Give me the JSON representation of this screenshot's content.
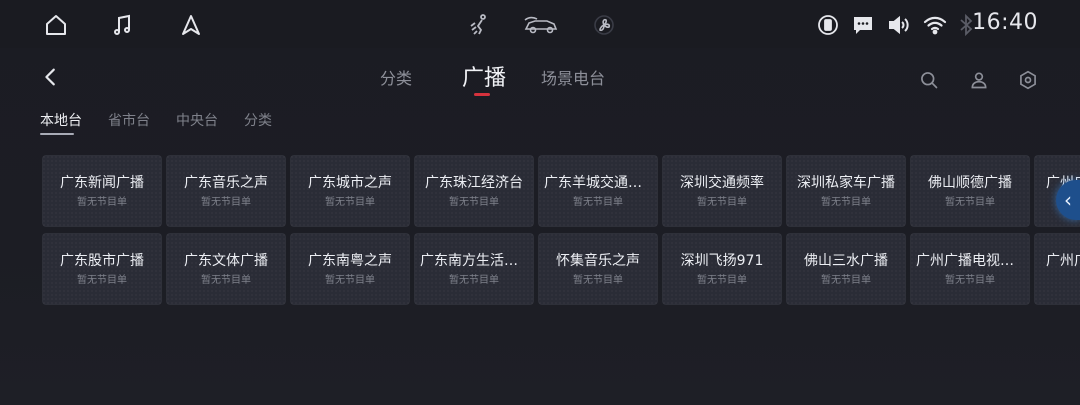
{
  "status_bar": {
    "time": "16:40",
    "left_icons": [
      "home-icon",
      "music-icon",
      "navigation-icon"
    ],
    "center_icons": [
      "climate-icon",
      "car-icon",
      "fan-icon"
    ],
    "right_icons": [
      "wireless-charge-icon",
      "message-icon",
      "volume-icon",
      "wifi-icon",
      "bluetooth-icon"
    ]
  },
  "nav": {
    "tabs": [
      {
        "label": "分类"
      },
      {
        "label": "广播"
      },
      {
        "label": "场景电台"
      }
    ],
    "active_tab": "广播",
    "accent_color": "#d6323d",
    "tools": [
      "search-icon",
      "user-icon",
      "settings-icon"
    ]
  },
  "sub_tabs": {
    "items": [
      {
        "label": "本地台"
      },
      {
        "label": "省市台"
      },
      {
        "label": "中央台"
      },
      {
        "label": "分类"
      }
    ],
    "active": "本地台"
  },
  "stations": {
    "row1": [
      {
        "name": "广东新闻广播",
        "sub": "暂无节目单"
      },
      {
        "name": "广东音乐之声",
        "sub": "暂无节目单"
      },
      {
        "name": "广东城市之声",
        "sub": "暂无节目单"
      },
      {
        "name": "广东珠江经济台",
        "sub": "暂无节目单"
      },
      {
        "name": "广东羊城交通广…",
        "sub": "暂无节目单"
      },
      {
        "name": "深圳交通频率",
        "sub": "暂无节目单"
      },
      {
        "name": "深圳私家车广播",
        "sub": "暂无节目单"
      },
      {
        "name": "佛山顺德广播",
        "sub": "暂无节目单"
      },
      {
        "name": "广州广",
        "sub": ""
      }
    ],
    "row2": [
      {
        "name": "广东股市广播",
        "sub": "暂无节目单"
      },
      {
        "name": "广东文体广播",
        "sub": "暂无节目单"
      },
      {
        "name": "广东南粤之声",
        "sub": "暂无节目单"
      },
      {
        "name": "广东南方生活广…",
        "sub": "暂无节目单"
      },
      {
        "name": "怀集音乐之声",
        "sub": "暂无节目单"
      },
      {
        "name": "深圳飞扬971",
        "sub": "暂无节目单"
      },
      {
        "name": "佛山三水广播",
        "sub": "暂无节目单"
      },
      {
        "name": "广州广播电视台…",
        "sub": "暂无节目单"
      },
      {
        "name": "广州广",
        "sub": ""
      }
    ]
  }
}
